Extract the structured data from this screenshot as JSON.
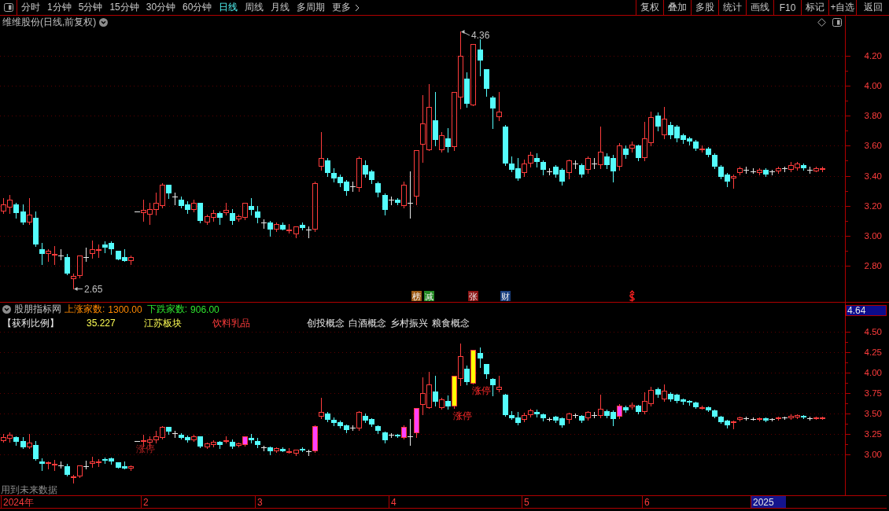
{
  "toolbar": {
    "tabs": [
      {
        "label": "分时",
        "kind": "period",
        "selected": false
      },
      {
        "label": "1分钟",
        "kind": "period",
        "selected": false
      },
      {
        "label": "5分钟",
        "kind": "period",
        "selected": false
      },
      {
        "label": "15分钟",
        "kind": "period",
        "selected": false
      },
      {
        "label": "30分钟",
        "kind": "period",
        "selected": false
      },
      {
        "label": "60分钟",
        "kind": "period",
        "selected": false
      },
      {
        "label": "日线",
        "kind": "period",
        "selected": true
      },
      {
        "label": "周线",
        "kind": "period",
        "selected": false
      },
      {
        "label": "月线",
        "kind": "period",
        "selected": false
      },
      {
        "label": "多周期",
        "kind": "period",
        "selected": false
      },
      {
        "label": "更多",
        "kind": "menu",
        "selected": false
      }
    ],
    "buttons": [
      "复权",
      "叠加",
      "多股",
      "统计",
      "画线",
      "F10",
      "标记",
      "+自选",
      "返回"
    ]
  },
  "main_panel": {
    "title": "维维股份(日线,前复权)",
    "price_axis": [
      "4.20",
      "4.00",
      "3.80",
      "3.60",
      "3.40",
      "3.20",
      "3.00",
      "2.80"
    ],
    "price_labels": [
      "4.36",
      "2.65"
    ],
    "event_marks": [
      {
        "kind": "tag",
        "label": "榜",
        "color": "#9c5a14"
      },
      {
        "kind": "tag",
        "label": "减",
        "color": "#238a23"
      },
      {
        "kind": "tag",
        "label": "张",
        "color": "#8c1414"
      },
      {
        "kind": "tag",
        "label": "财",
        "color": "#1a4080"
      },
      {
        "kind": "dollar",
        "color": "#ff2020"
      }
    ]
  },
  "indicator_panel": {
    "name": "股朋指标网",
    "stats": [
      {
        "label": "上涨家数:",
        "value": "1300.00",
        "color": "#ff8800"
      },
      {
        "label": "下跌家数:",
        "value": "906.00",
        "color": "#2ee62e"
      }
    ],
    "info": [
      {
        "kind": "title",
        "text": "【获利比例】"
      },
      {
        "kind": "value",
        "text": "35.227"
      },
      {
        "kind": "region",
        "text": "江苏板块"
      },
      {
        "kind": "industry",
        "text": "饮料乳品"
      },
      {
        "kind": "concept",
        "text": "创投概念"
      },
      {
        "kind": "concept",
        "text": "白酒概念"
      },
      {
        "kind": "concept",
        "text": "乡村振兴"
      },
      {
        "kind": "concept",
        "text": "粮食概念"
      }
    ],
    "current_value": "4.64",
    "price_axis": [
      "4.50",
      "4.25",
      "4.00",
      "3.75",
      "3.50",
      "3.25",
      "3.00"
    ],
    "chart_labels": [
      "涨停",
      "涨停",
      "涨停"
    ],
    "footnote": "用到未来数据",
    "date_axis": [
      {
        "label": "2024年",
        "highlighted": false
      },
      {
        "label": "2",
        "highlighted": false
      },
      {
        "label": "3",
        "highlighted": false
      },
      {
        "label": "4",
        "highlighted": false
      },
      {
        "label": "5",
        "highlighted": false
      },
      {
        "label": "6",
        "highlighted": false
      },
      {
        "label": "2025",
        "highlighted": true
      }
    ]
  }
}
